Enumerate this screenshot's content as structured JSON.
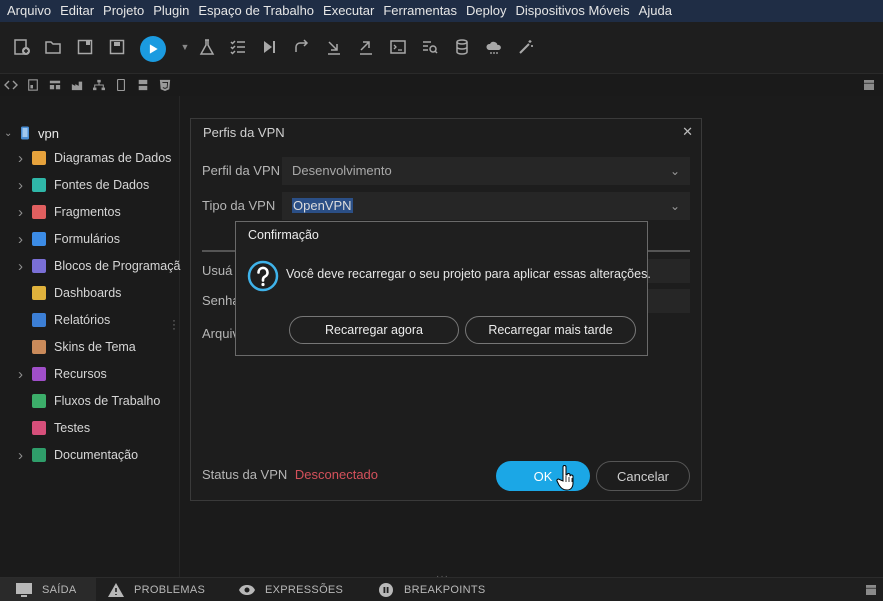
{
  "menubar": {
    "items": [
      "Arquivo",
      "Editar",
      "Projeto",
      "Plugin",
      "Espaço de Trabalho",
      "Executar",
      "Ferramentas",
      "Deploy",
      "Dispositivos Móveis",
      "Ajuda"
    ]
  },
  "sidebar": {
    "project": "vpn",
    "items": [
      {
        "label": "Diagramas de Dados",
        "expandable": true,
        "color": "#e6a23c"
      },
      {
        "label": "Fontes de Dados",
        "expandable": true,
        "color": "#2fb7a8"
      },
      {
        "label": "Fragmentos",
        "expandable": true,
        "color": "#e05f5f"
      },
      {
        "label": "Formulários",
        "expandable": true,
        "color": "#3c8ce6"
      },
      {
        "label": "Blocos de Programaçã",
        "expandable": true,
        "color": "#7a6fd6"
      },
      {
        "label": "Dashboards",
        "expandable": false,
        "color": "#e0b23c"
      },
      {
        "label": "Relatórios",
        "expandable": false,
        "color": "#3c7fd6"
      },
      {
        "label": "Skins de Tema",
        "expandable": false,
        "color": "#c98a5a"
      },
      {
        "label": "Recursos",
        "expandable": true,
        "color": "#a04fc9"
      },
      {
        "label": "Fluxos de Trabalho",
        "expandable": false,
        "color": "#3cae6a"
      },
      {
        "label": "Testes",
        "expandable": false,
        "color": "#d64f7a"
      },
      {
        "label": "Documentação",
        "expandable": true,
        "color": "#2f9e6a"
      }
    ]
  },
  "bottombar": {
    "tabs": [
      "SAÍDA",
      "PROBLEMAS",
      "EXPRESSÕES",
      "BREAKPOINTS"
    ]
  },
  "vpn_dialog": {
    "title": "Perfis da VPN",
    "profile_label": "Perfil da VPN",
    "profile_value": "Desenvolvimento",
    "type_label": "Tipo da VPN",
    "type_value": "OpenVPN",
    "user_label": "Usuá",
    "password_label": "Senha",
    "file_label": "Arquiv",
    "status_label": "Status da VPN",
    "status_value": "Desconectado",
    "ok_label": "OK",
    "cancel_label": "Cancelar"
  },
  "confirm_dialog": {
    "title": "Confirmação",
    "message": "Você deve recarregar o seu projeto para aplicar essas alterações.",
    "reload_now": "Recarregar agora",
    "reload_later": "Recarregar mais tarde"
  },
  "colors": {
    "accent": "#1ba7e6",
    "status_disconnected": "#d4515b",
    "menubar_bg": "#1f2d45"
  }
}
